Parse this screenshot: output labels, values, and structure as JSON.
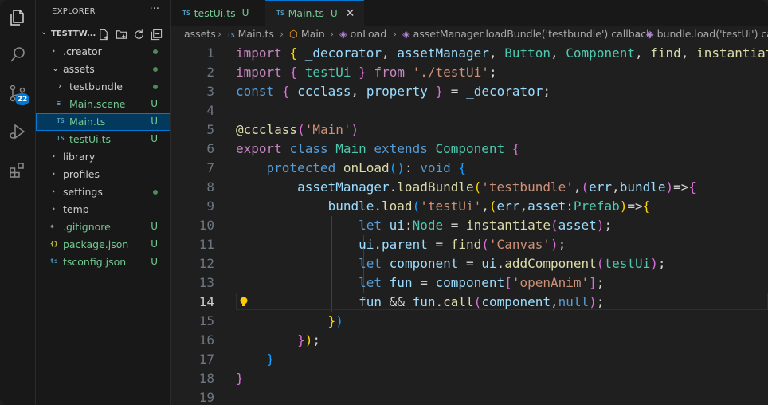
{
  "explorer": {
    "title": "EXPLORER",
    "more": "···",
    "project": "TESTTW...",
    "tree": [
      {
        "label": "› .creator",
        "indent": 1,
        "status": "dot"
      },
      {
        "label": "assets",
        "indent": 1,
        "status": "dot",
        "open": true
      },
      {
        "label": "testbundle",
        "indent": 2,
        "status": "dot"
      },
      {
        "label": "Main.scene",
        "indent": 2,
        "status": "U",
        "icon": "scene"
      },
      {
        "label": "Main.ts",
        "indent": 2,
        "status": "U",
        "icon": "ts",
        "selected": true
      },
      {
        "label": "testUi.ts",
        "indent": 2,
        "status": "U",
        "icon": "ts"
      },
      {
        "label": "library",
        "indent": 1
      },
      {
        "label": "profiles",
        "indent": 1
      },
      {
        "label": "settings",
        "indent": 1,
        "status": "dot"
      },
      {
        "label": "temp",
        "indent": 1
      },
      {
        "label": ".gitignore",
        "indent": 1,
        "status": "U",
        "icon": "git"
      },
      {
        "label": "package.json",
        "indent": 1,
        "status": "U",
        "icon": "json"
      },
      {
        "label": "tsconfig.json",
        "indent": 1,
        "status": "U",
        "icon": "tsconfig"
      }
    ]
  },
  "activity": {
    "scm_badge": "22"
  },
  "tabs": [
    {
      "icon": "TS",
      "label": "testUi.ts",
      "status": "U"
    },
    {
      "icon": "TS",
      "label": "Main.ts",
      "status": "U",
      "close": "✕"
    }
  ],
  "breadcrumb": [
    "assets",
    "Main.ts",
    "Main",
    "onLoad",
    "assetManager.loadBundle('testbundle') callback",
    "bundle.load('testUi') callback"
  ],
  "editor": {
    "current_line": 14,
    "lines": [
      {
        "n": "1",
        "code": "import { _decorator, assetManager, Button, Component, find, instantiate"
      },
      {
        "n": "2",
        "code": "import { testUi } from './testUi';"
      },
      {
        "n": "3",
        "code": "const { ccclass, property } = _decorator;"
      },
      {
        "n": "4",
        "code": ""
      },
      {
        "n": "5",
        "code": "@ccclass('Main')"
      },
      {
        "n": "6",
        "code": "export class Main extends Component {"
      },
      {
        "n": "7",
        "code": "    protected onLoad(): void {"
      },
      {
        "n": "8",
        "code": "        assetManager.loadBundle('testbundle',(err,bundle)=>{"
      },
      {
        "n": "9",
        "code": "            bundle.load('testUi',(err,asset:Prefab)=>{"
      },
      {
        "n": "10",
        "code": "                let ui:Node = instantiate(asset);"
      },
      {
        "n": "11",
        "code": "                ui.parent = find('Canvas');"
      },
      {
        "n": "12",
        "code": "                let component = ui.addComponent(testUi);"
      },
      {
        "n": "13",
        "code": "                let fun = component['openAnim'];"
      },
      {
        "n": "14",
        "code": "                fun && fun.call(component,null);"
      },
      {
        "n": "15",
        "code": "            })"
      },
      {
        "n": "16",
        "code": "        });"
      },
      {
        "n": "17",
        "code": "    }"
      },
      {
        "n": "18",
        "code": "}"
      },
      {
        "n": "19",
        "code": ""
      }
    ]
  },
  "colors": {
    "accent": "#0078d4",
    "untracked": "#73c991",
    "keyword": "#569cd6",
    "string": "#ce9178",
    "type": "#4ec9b0",
    "function": "#dcdcaa"
  }
}
